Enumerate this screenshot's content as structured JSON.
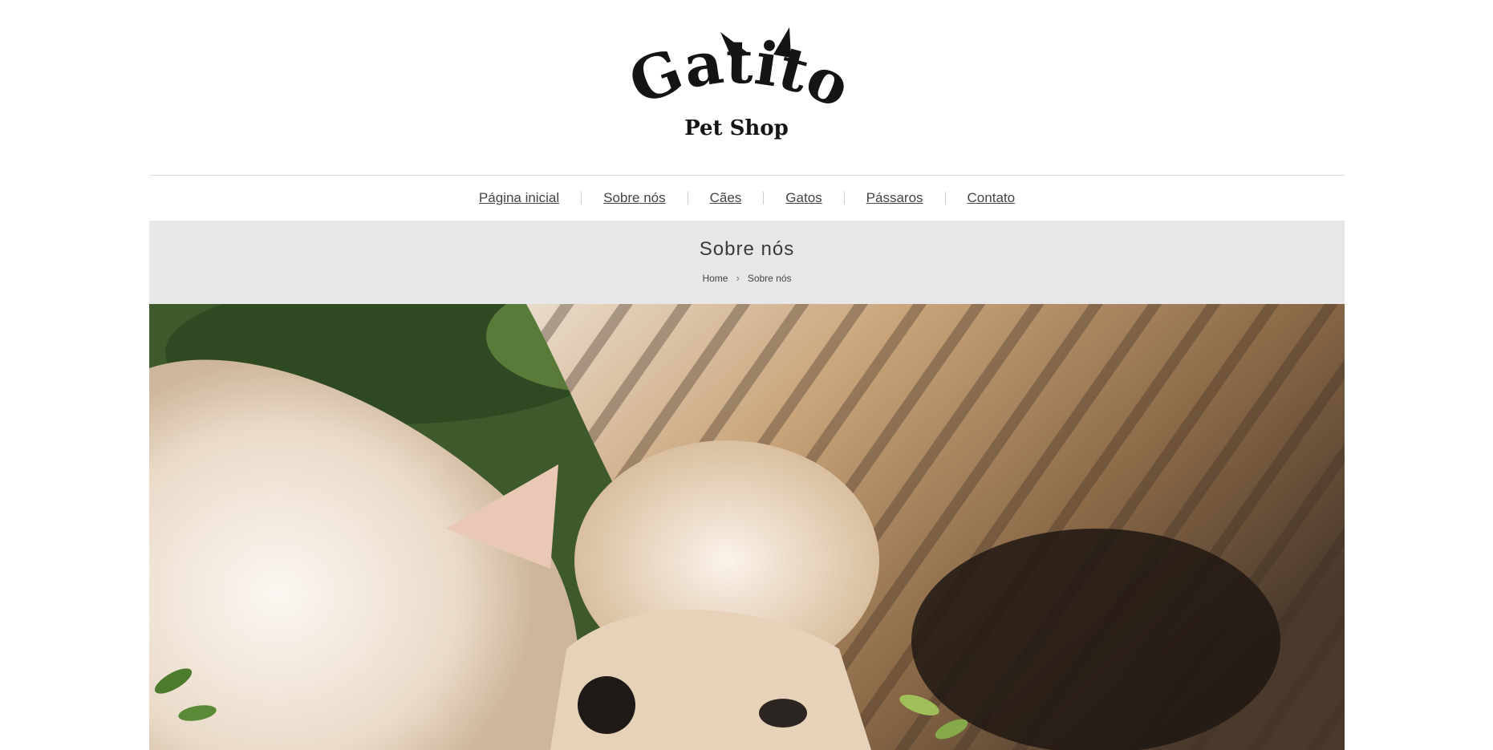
{
  "brand": {
    "name": "Gatito",
    "tagline": "Pet Shop"
  },
  "nav": {
    "items": [
      {
        "label": "Página inicial"
      },
      {
        "label": "Sobre nós"
      },
      {
        "label": "Cães"
      },
      {
        "label": "Gatos"
      },
      {
        "label": "Pássaros"
      },
      {
        "label": "Contato"
      }
    ]
  },
  "page": {
    "title": "Sobre nós",
    "breadcrumb": {
      "home": "Home",
      "current": "Sobre nós"
    }
  },
  "colors": {
    "band": "#e7e7e9",
    "text": "#444444",
    "logo": "#141414"
  },
  "hero": {
    "icon": "cat-and-dog-photo"
  }
}
